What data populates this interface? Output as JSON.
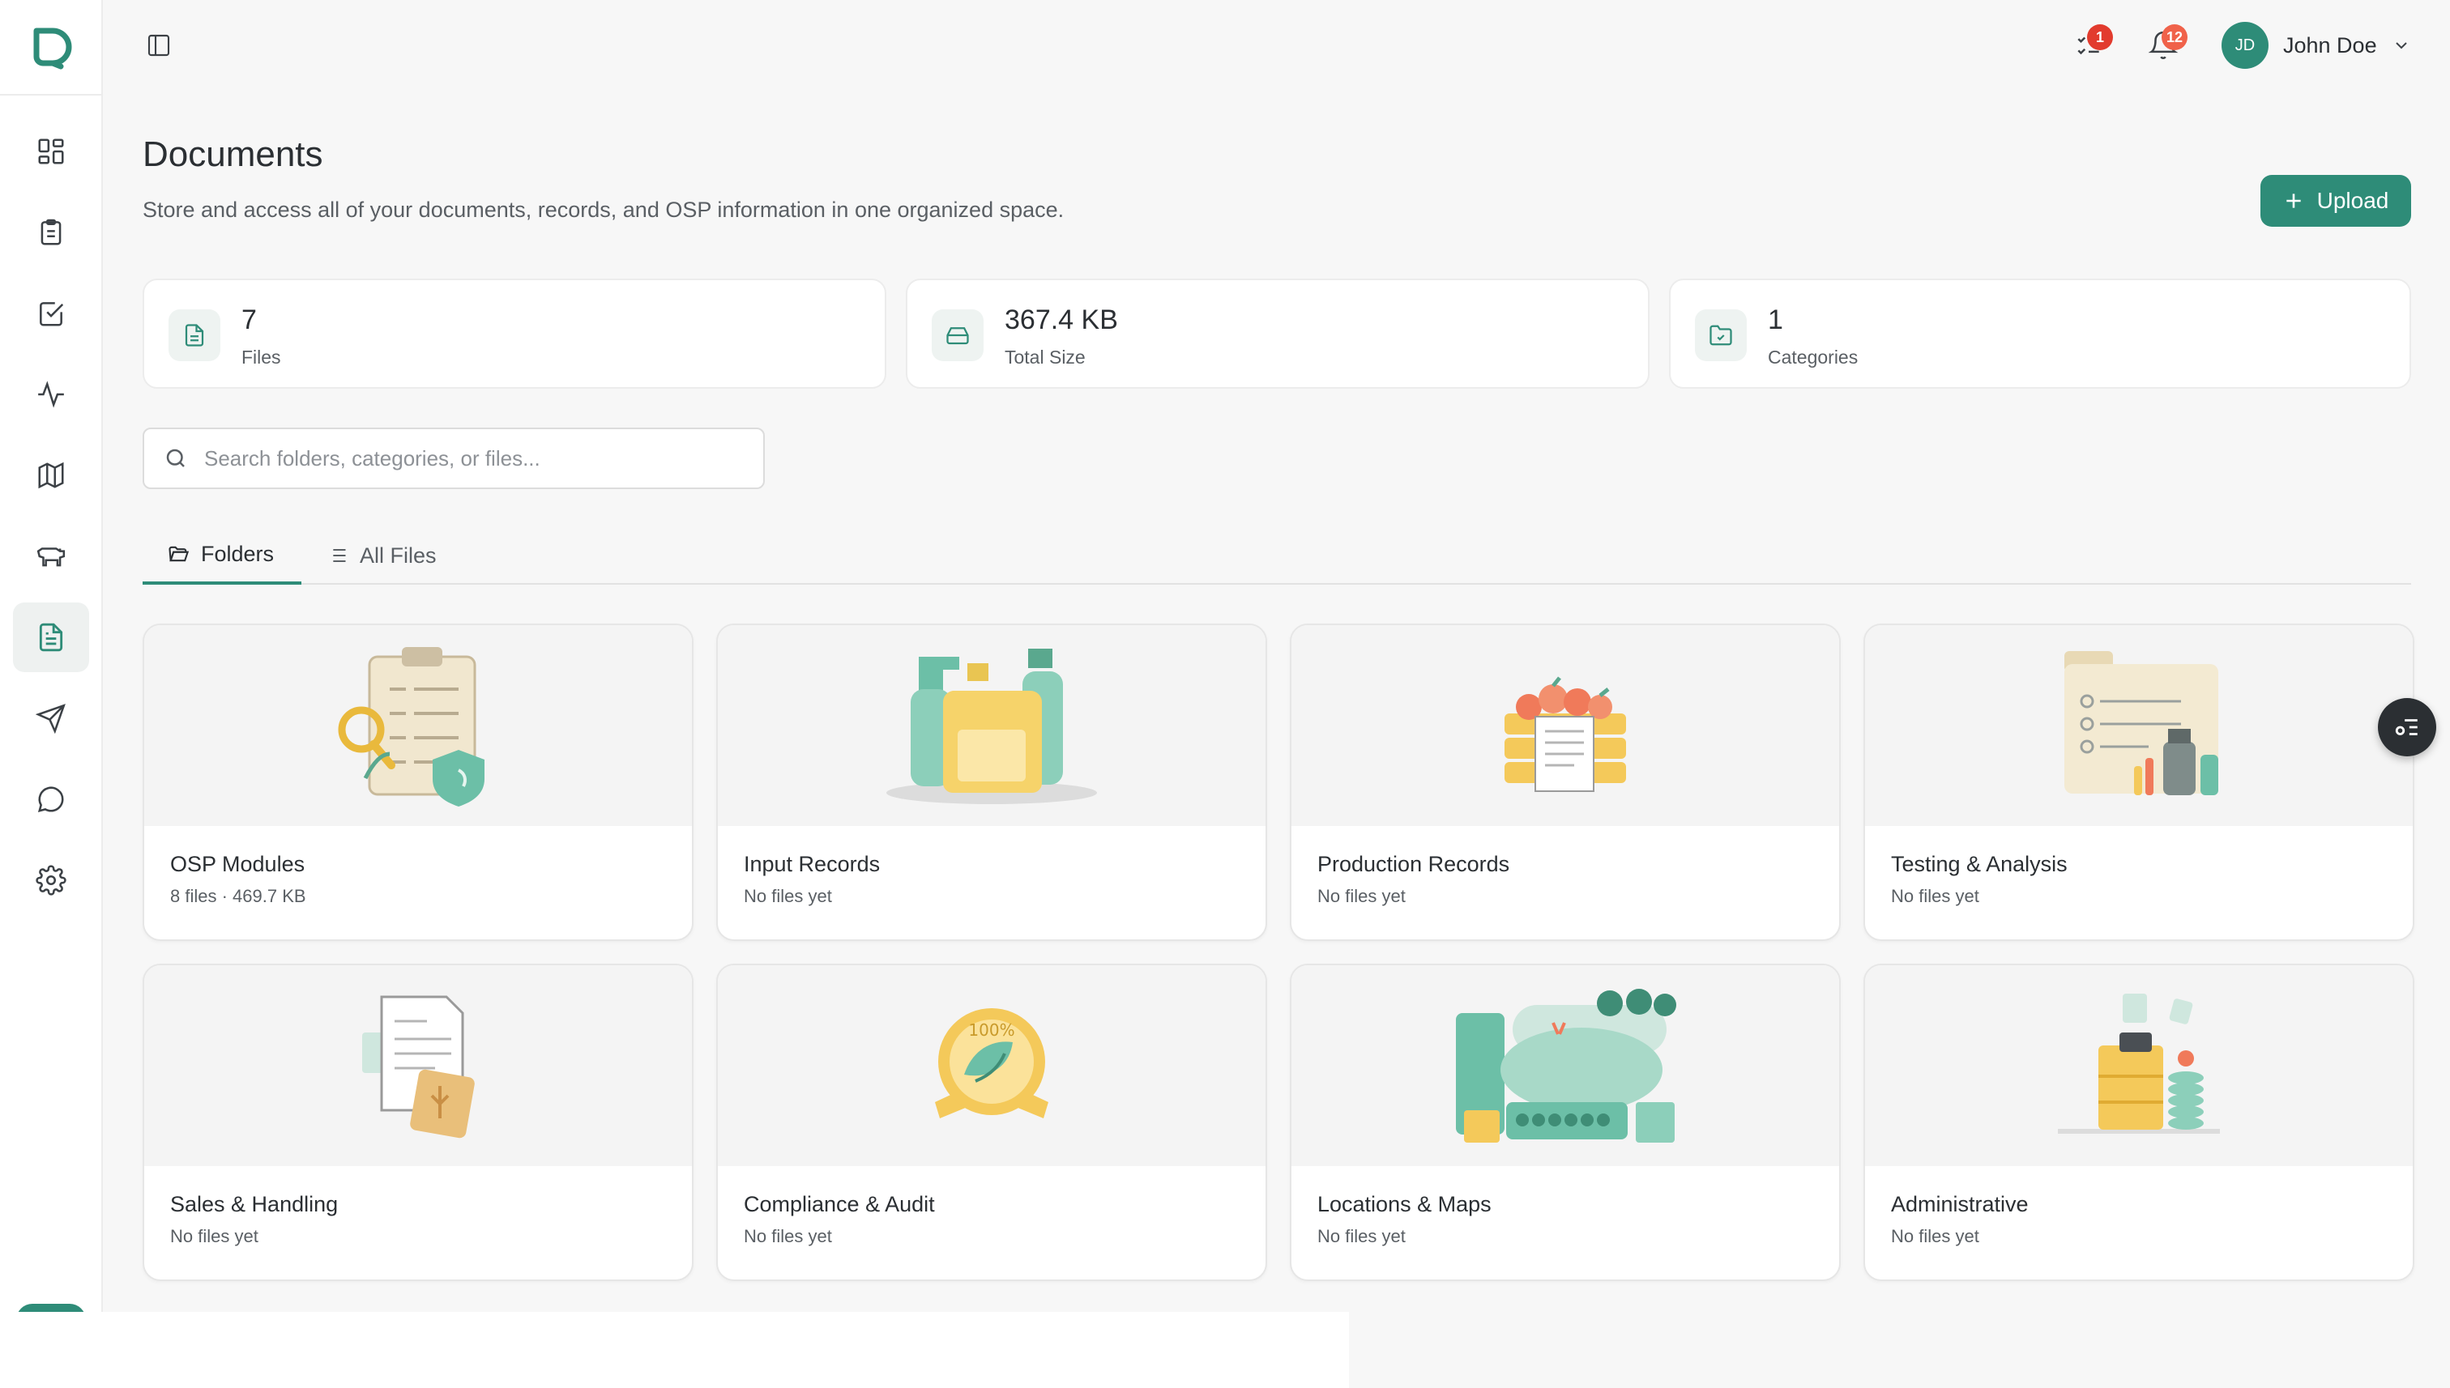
{
  "app": {
    "logo": "app-logo"
  },
  "sidebar": {
    "items": [
      {
        "name": "dashboard",
        "icon": "grid-icon"
      },
      {
        "name": "tasks",
        "icon": "clipboard-icon"
      },
      {
        "name": "checklist",
        "icon": "checkbox-icon"
      },
      {
        "name": "activity",
        "icon": "pulse-icon"
      },
      {
        "name": "maps",
        "icon": "map-icon"
      },
      {
        "name": "livestock",
        "icon": "cow-icon"
      },
      {
        "name": "documents",
        "icon": "document-icon",
        "active": true
      },
      {
        "name": "send",
        "icon": "send-icon"
      },
      {
        "name": "messages",
        "icon": "chat-icon"
      },
      {
        "name": "settings",
        "icon": "gear-icon"
      }
    ]
  },
  "header": {
    "tasks_badge": "1",
    "notifications_badge": "12",
    "user": {
      "initials": "JD",
      "name": "John Doe"
    }
  },
  "page": {
    "title": "Documents",
    "subtitle": "Store and access all of your documents, records, and OSP information in one organized space.",
    "upload_label": "Upload"
  },
  "stats": [
    {
      "value": "7",
      "label": "Files",
      "icon": "file-icon"
    },
    {
      "value": "367.4 KB",
      "label": "Total Size",
      "icon": "drive-icon"
    },
    {
      "value": "1",
      "label": "Categories",
      "icon": "folder-icon"
    }
  ],
  "search": {
    "placeholder": "Search folders, categories, or files...",
    "value": ""
  },
  "tabs": [
    {
      "label": "Folders",
      "active": true,
      "icon": "folder-open-icon"
    },
    {
      "label": "All Files",
      "active": false,
      "icon": "list-icon"
    }
  ],
  "folders": [
    {
      "name": "OSP Modules",
      "meta": "8 files · 469.7 KB",
      "art": "clipboard-shield-illustration"
    },
    {
      "name": "Input Records",
      "meta": "No files yet",
      "art": "spray-bottles-illustration"
    },
    {
      "name": "Production Records",
      "meta": "No files yet",
      "art": "crates-document-illustration"
    },
    {
      "name": "Testing & Analysis",
      "meta": "No files yet",
      "art": "lab-folder-illustration"
    },
    {
      "name": "Sales & Handling",
      "meta": "No files yet",
      "art": "invoice-bag-illustration"
    },
    {
      "name": "Compliance & Audit",
      "meta": "No files yet",
      "art": "organic-seal-illustration",
      "seal_text": "100%"
    },
    {
      "name": "Locations & Maps",
      "meta": "No files yet",
      "art": "farm-map-illustration"
    },
    {
      "name": "Administrative",
      "meta": "No files yet",
      "art": "drawer-coins-illustration"
    }
  ],
  "colors": {
    "accent": "#2e8c78",
    "badge_red": "#e23b2e",
    "badge_orange": "#f0624a",
    "background": "#f7f7f7"
  }
}
